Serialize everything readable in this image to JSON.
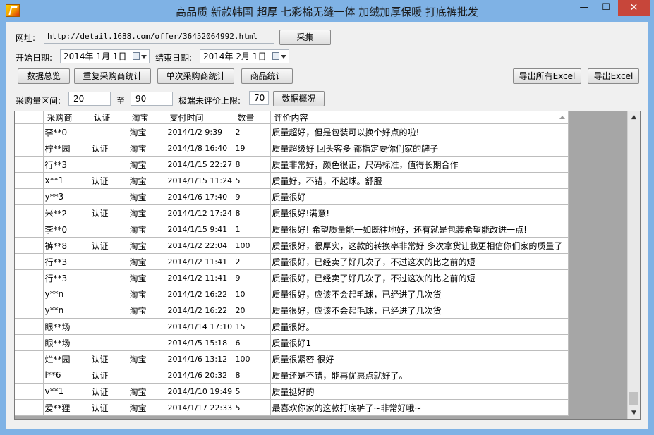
{
  "window": {
    "title": "高品质 新款韩国 超厚 七彩棉无缝一体 加绒加厚保暖 打底裤批发",
    "min_glyph": "—",
    "max_glyph": "☐",
    "close_glyph": "✕"
  },
  "form": {
    "url_label": "网址:",
    "url_value": "http://detail.1688.com/offer/36452064992.html",
    "collect_button": "采集",
    "start_date_label": "开始日期:",
    "start_date_value": "2014年 1月 1日",
    "end_date_label": "结束日期:",
    "end_date_value": "2014年 2月 1日"
  },
  "toolbar": {
    "data_summary": "数据总览",
    "repeat_buyer_stats": "重复采购商统计",
    "single_buyer_stats": "单次采购商统计",
    "product_stats": "商品统计",
    "export_all_excel": "导出所有Excel",
    "export_excel": "导出Excel"
  },
  "filter": {
    "qty_range_label": "采购量区间:",
    "qty_min": "20",
    "to_label": "至",
    "qty_max": "90",
    "extreme_review_label": "极端未评价上限:",
    "extreme_review_value": "70",
    "data_overview_button": "数据概况"
  },
  "grid": {
    "columns": [
      "采购商",
      "认证",
      "淘宝",
      "支付时间",
      "数量",
      "评价内容"
    ],
    "rows": [
      [
        "李**0",
        "",
        "淘宝",
        "2014/1/2 9:39",
        "2",
        "质量超好，但是包装可以换个好点的啦!"
      ],
      [
        "柠**园",
        "认证",
        "淘宝",
        "2014/1/8 16:40",
        "19",
        "质量超级好 回头客多 都指定要你们家的牌子"
      ],
      [
        "行**3",
        "",
        "淘宝",
        "2014/1/15 22:27",
        "8",
        "质量非常好，颜色很正，尺码标准，值得长期合作"
      ],
      [
        "x**1",
        "认证",
        "淘宝",
        "2014/1/15 11:24",
        "5",
        "质量好，不错，不起球。舒服"
      ],
      [
        "y**3",
        "",
        "淘宝",
        "2014/1/6 17:40",
        "9",
        "质量很好"
      ],
      [
        "米**2",
        "认证",
        "淘宝",
        "2014/1/12 17:24",
        "8",
        "质量很好!满意!"
      ],
      [
        "李**0",
        "",
        "淘宝",
        "2014/1/15 9:41",
        "1",
        "质量很好! 希望质量能一如既往地好，还有就是包装希望能改进一点!"
      ],
      [
        "裤**8",
        "认证",
        "淘宝",
        "2014/1/2 22:04",
        "100",
        "质量很好，很厚实，这款的转换率非常好 多次拿货让我更相信你们家的质量了"
      ],
      [
        "行**3",
        "",
        "淘宝",
        "2014/1/2 11:41",
        "2",
        "质量很好，已经卖了好几次了，不过这次的比之前的短"
      ],
      [
        "行**3",
        "",
        "淘宝",
        "2014/1/2 11:41",
        "9",
        "质量很好，已经卖了好几次了，不过这次的比之前的短"
      ],
      [
        "y**n",
        "",
        "淘宝",
        "2014/1/2 16:22",
        "10",
        "质量很好，应该不会起毛球，已经进了几次货"
      ],
      [
        "y**n",
        "",
        "淘宝",
        "2014/1/2 16:22",
        "20",
        "质量很好，应该不会起毛球，已经进了几次货"
      ],
      [
        "眼**场",
        "",
        "",
        "2014/1/14 17:10",
        "15",
        "质量很好。"
      ],
      [
        "眼**场",
        "",
        "",
        "2014/1/5 15:18",
        "6",
        "质量很好1"
      ],
      [
        "烂**园",
        "认证",
        "淘宝",
        "2014/1/6 13:12",
        "100",
        "质量很紧密 很好"
      ],
      [
        "l**6",
        "认证",
        "",
        "2014/1/6 20:32",
        "8",
        "质量还是不错，能再优惠点就好了。"
      ],
      [
        "v**1",
        "认证",
        "淘宝",
        "2014/1/10 19:49",
        "5",
        "质量挺好的"
      ],
      [
        "爱**狸",
        "认证",
        "淘宝",
        "2014/1/17 22:33",
        "5",
        "最喜欢你家的这款打底裤了~非常好哦~"
      ]
    ],
    "scroll_up_glyph": "▲",
    "scroll_down_glyph": "▼"
  }
}
